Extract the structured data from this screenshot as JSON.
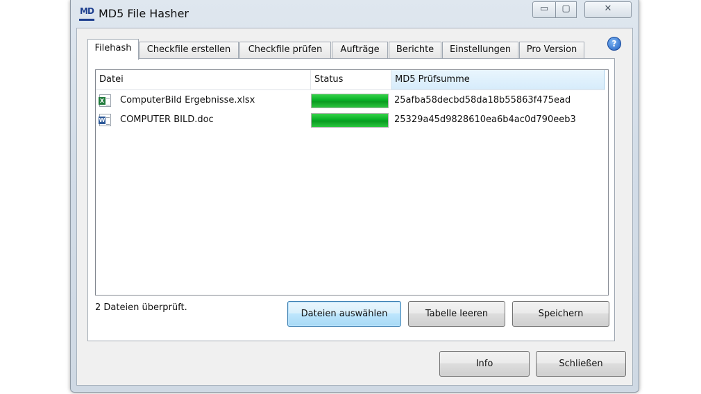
{
  "window": {
    "title": "MD5 File Hasher",
    "icon_text": "MD",
    "caption": {
      "minimize": "▭",
      "maximize": "▢",
      "close": "✕"
    }
  },
  "help_icon": {
    "glyph": "?"
  },
  "tabs": [
    {
      "label": "Filehash",
      "active": true
    },
    {
      "label": "Checkfile erstellen",
      "active": false
    },
    {
      "label": "Checkfile prüfen",
      "active": false
    },
    {
      "label": "Aufträge",
      "active": false
    },
    {
      "label": "Berichte",
      "active": false
    },
    {
      "label": "Einstellungen",
      "active": false
    },
    {
      "label": "Pro Version",
      "active": false
    }
  ],
  "table": {
    "columns": [
      "Datei",
      "Status",
      "MD5 Prüfsumme"
    ],
    "rows": [
      {
        "icon": "excel-file-icon",
        "icon_badge": "X",
        "file": "ComputerBild Ergebnisse.xlsx",
        "progress": 1.0,
        "hash": "25afba58decbd58da18b55863f475ead"
      },
      {
        "icon": "word-file-icon",
        "icon_badge": "W",
        "file": "COMPUTER BILD.doc",
        "progress": 1.0,
        "hash": "25329a45d9828610ea6b4ac0d790eeb3"
      }
    ]
  },
  "status_text": "2 Dateien überprüft.",
  "buttons": {
    "select_files": "Dateien auswählen",
    "clear_table": "Tabelle leeren",
    "save": "Speichern",
    "info": "Info",
    "close": "Schließen"
  },
  "colors": {
    "progress_green": "#06b025",
    "excel_green": "#1f7a3a",
    "word_blue": "#2b5797"
  }
}
